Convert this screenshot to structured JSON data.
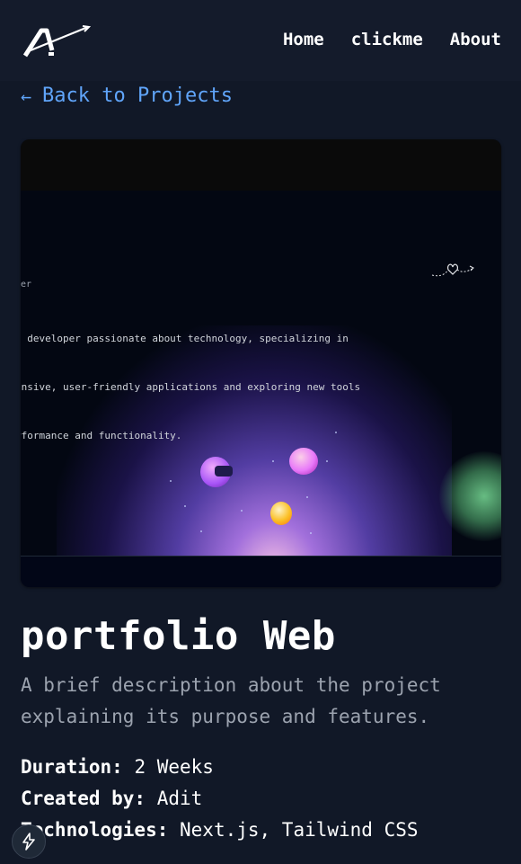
{
  "header": {
    "logo_icon": "stylized-a-arrow-logo",
    "nav": [
      "Home",
      "clickme",
      "About"
    ]
  },
  "back_link": {
    "icon": "arrow-left-icon",
    "label": "Back to Projects"
  },
  "preview": {
    "role_text": "per",
    "body_lines": [
      "e developer passionate about technology, specializing in",
      "onsive, user-friendly applications and exploring new tools",
      "rformance and functionality."
    ]
  },
  "project": {
    "title": "portfolio Web",
    "description": "A brief description about the project explaining its purpose and features.",
    "duration_label": "Duration:",
    "duration_value": "2 Weeks",
    "created_label": "Created by:",
    "created_value": "Adit",
    "tech_label": "Technologies:",
    "tech_value": "Next.js, Tailwind CSS"
  },
  "badge_icon": "lightning-bolt-icon",
  "colors": {
    "background": "#111827",
    "accent_link": "#60a5fa",
    "muted_text": "#9ca3af"
  }
}
